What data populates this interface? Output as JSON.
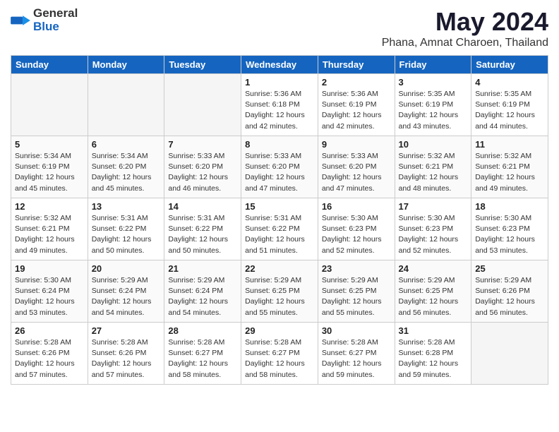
{
  "header": {
    "logo_general": "General",
    "logo_blue": "Blue",
    "month": "May 2024",
    "location": "Phana, Amnat Charoen, Thailand"
  },
  "days_of_week": [
    "Sunday",
    "Monday",
    "Tuesday",
    "Wednesday",
    "Thursday",
    "Friday",
    "Saturday"
  ],
  "weeks": [
    [
      {
        "num": "",
        "info": "",
        "empty": true
      },
      {
        "num": "",
        "info": "",
        "empty": true
      },
      {
        "num": "",
        "info": "",
        "empty": true
      },
      {
        "num": "1",
        "info": "Sunrise: 5:36 AM\nSunset: 6:18 PM\nDaylight: 12 hours\nand 42 minutes.",
        "empty": false
      },
      {
        "num": "2",
        "info": "Sunrise: 5:36 AM\nSunset: 6:19 PM\nDaylight: 12 hours\nand 42 minutes.",
        "empty": false
      },
      {
        "num": "3",
        "info": "Sunrise: 5:35 AM\nSunset: 6:19 PM\nDaylight: 12 hours\nand 43 minutes.",
        "empty": false
      },
      {
        "num": "4",
        "info": "Sunrise: 5:35 AM\nSunset: 6:19 PM\nDaylight: 12 hours\nand 44 minutes.",
        "empty": false
      }
    ],
    [
      {
        "num": "5",
        "info": "Sunrise: 5:34 AM\nSunset: 6:19 PM\nDaylight: 12 hours\nand 45 minutes.",
        "empty": false
      },
      {
        "num": "6",
        "info": "Sunrise: 5:34 AM\nSunset: 6:20 PM\nDaylight: 12 hours\nand 45 minutes.",
        "empty": false
      },
      {
        "num": "7",
        "info": "Sunrise: 5:33 AM\nSunset: 6:20 PM\nDaylight: 12 hours\nand 46 minutes.",
        "empty": false
      },
      {
        "num": "8",
        "info": "Sunrise: 5:33 AM\nSunset: 6:20 PM\nDaylight: 12 hours\nand 47 minutes.",
        "empty": false
      },
      {
        "num": "9",
        "info": "Sunrise: 5:33 AM\nSunset: 6:20 PM\nDaylight: 12 hours\nand 47 minutes.",
        "empty": false
      },
      {
        "num": "10",
        "info": "Sunrise: 5:32 AM\nSunset: 6:21 PM\nDaylight: 12 hours\nand 48 minutes.",
        "empty": false
      },
      {
        "num": "11",
        "info": "Sunrise: 5:32 AM\nSunset: 6:21 PM\nDaylight: 12 hours\nand 49 minutes.",
        "empty": false
      }
    ],
    [
      {
        "num": "12",
        "info": "Sunrise: 5:32 AM\nSunset: 6:21 PM\nDaylight: 12 hours\nand 49 minutes.",
        "empty": false
      },
      {
        "num": "13",
        "info": "Sunrise: 5:31 AM\nSunset: 6:22 PM\nDaylight: 12 hours\nand 50 minutes.",
        "empty": false
      },
      {
        "num": "14",
        "info": "Sunrise: 5:31 AM\nSunset: 6:22 PM\nDaylight: 12 hours\nand 50 minutes.",
        "empty": false
      },
      {
        "num": "15",
        "info": "Sunrise: 5:31 AM\nSunset: 6:22 PM\nDaylight: 12 hours\nand 51 minutes.",
        "empty": false
      },
      {
        "num": "16",
        "info": "Sunrise: 5:30 AM\nSunset: 6:23 PM\nDaylight: 12 hours\nand 52 minutes.",
        "empty": false
      },
      {
        "num": "17",
        "info": "Sunrise: 5:30 AM\nSunset: 6:23 PM\nDaylight: 12 hours\nand 52 minutes.",
        "empty": false
      },
      {
        "num": "18",
        "info": "Sunrise: 5:30 AM\nSunset: 6:23 PM\nDaylight: 12 hours\nand 53 minutes.",
        "empty": false
      }
    ],
    [
      {
        "num": "19",
        "info": "Sunrise: 5:30 AM\nSunset: 6:24 PM\nDaylight: 12 hours\nand 53 minutes.",
        "empty": false
      },
      {
        "num": "20",
        "info": "Sunrise: 5:29 AM\nSunset: 6:24 PM\nDaylight: 12 hours\nand 54 minutes.",
        "empty": false
      },
      {
        "num": "21",
        "info": "Sunrise: 5:29 AM\nSunset: 6:24 PM\nDaylight: 12 hours\nand 54 minutes.",
        "empty": false
      },
      {
        "num": "22",
        "info": "Sunrise: 5:29 AM\nSunset: 6:25 PM\nDaylight: 12 hours\nand 55 minutes.",
        "empty": false
      },
      {
        "num": "23",
        "info": "Sunrise: 5:29 AM\nSunset: 6:25 PM\nDaylight: 12 hours\nand 55 minutes.",
        "empty": false
      },
      {
        "num": "24",
        "info": "Sunrise: 5:29 AM\nSunset: 6:25 PM\nDaylight: 12 hours\nand 56 minutes.",
        "empty": false
      },
      {
        "num": "25",
        "info": "Sunrise: 5:29 AM\nSunset: 6:26 PM\nDaylight: 12 hours\nand 56 minutes.",
        "empty": false
      }
    ],
    [
      {
        "num": "26",
        "info": "Sunrise: 5:28 AM\nSunset: 6:26 PM\nDaylight: 12 hours\nand 57 minutes.",
        "empty": false
      },
      {
        "num": "27",
        "info": "Sunrise: 5:28 AM\nSunset: 6:26 PM\nDaylight: 12 hours\nand 57 minutes.",
        "empty": false
      },
      {
        "num": "28",
        "info": "Sunrise: 5:28 AM\nSunset: 6:27 PM\nDaylight: 12 hours\nand 58 minutes.",
        "empty": false
      },
      {
        "num": "29",
        "info": "Sunrise: 5:28 AM\nSunset: 6:27 PM\nDaylight: 12 hours\nand 58 minutes.",
        "empty": false
      },
      {
        "num": "30",
        "info": "Sunrise: 5:28 AM\nSunset: 6:27 PM\nDaylight: 12 hours\nand 59 minutes.",
        "empty": false
      },
      {
        "num": "31",
        "info": "Sunrise: 5:28 AM\nSunset: 6:28 PM\nDaylight: 12 hours\nand 59 minutes.",
        "empty": false
      },
      {
        "num": "",
        "info": "",
        "empty": true
      }
    ]
  ]
}
